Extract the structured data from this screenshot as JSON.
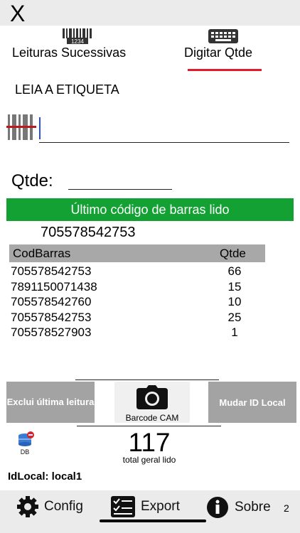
{
  "header": {
    "close_label": "X"
  },
  "modes": {
    "left_label": "Leituras Sucessivas",
    "left_icon_text": "1234",
    "right_label": "Digitar Qtde",
    "accent": "#e21b2a"
  },
  "instruction": "LEIA  A ETIQUETA",
  "barcode_input": {
    "value": ""
  },
  "qtde": {
    "label": "Qtde:",
    "value": ""
  },
  "banner": {
    "text": "Último código de barras lido",
    "color": "#12a132"
  },
  "last_code": "705578542753",
  "table": {
    "headers": [
      "CodBarras",
      "Qtde"
    ],
    "rows": [
      {
        "cod": "705578542753",
        "qtde": "66"
      },
      {
        "cod": "7891150071438",
        "qtde": "15"
      },
      {
        "cod": "705578542760",
        "qtde": "10"
      },
      {
        "cod": "705578542753",
        "qtde": "25"
      },
      {
        "cod": "705578527903",
        "qtde": "1"
      }
    ]
  },
  "actions": {
    "delete_last": "Exclui última leitura",
    "camera": "Barcode CAM",
    "change_local": "Mudar ID Local"
  },
  "db_label": "DB",
  "total": {
    "value": "117",
    "label": "total geral lido"
  },
  "idlocal": "IdLocal: local1",
  "nav": {
    "config": "Config",
    "export": "Export",
    "sobre": "Sobre",
    "page_num": "2"
  }
}
